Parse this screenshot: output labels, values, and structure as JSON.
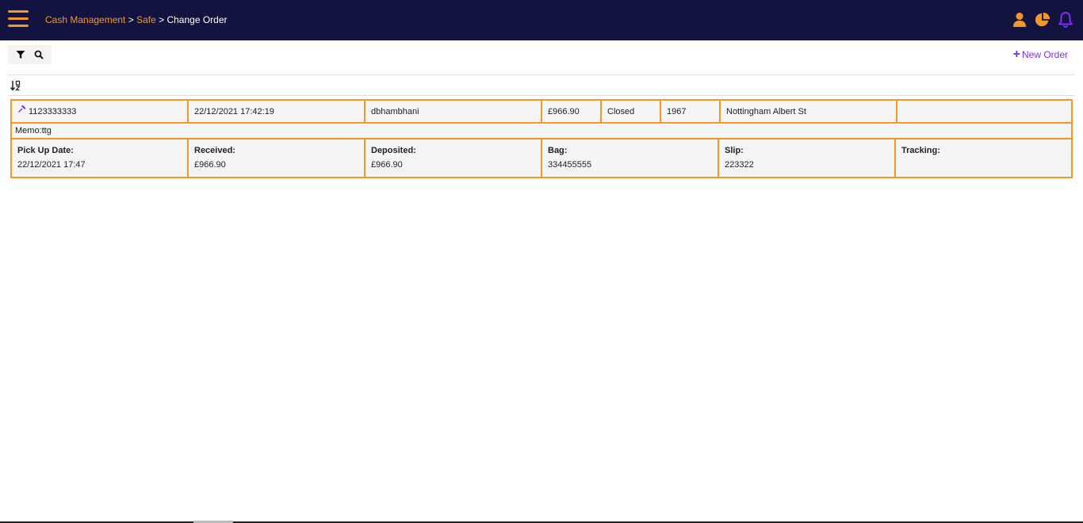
{
  "header": {
    "breadcrumb": {
      "item1": "Cash Management",
      "sep1": " > ",
      "item2": "Safe",
      "sep2": " > ",
      "current": "Change Order"
    },
    "icons": [
      "menu-icon",
      "user-icon",
      "pie-chart-icon",
      "bell-icon"
    ],
    "colors": {
      "bar": "#13133f",
      "accent": "#f5962a",
      "purple": "#7b2ff2"
    }
  },
  "toolbar": {
    "icons": [
      "filter-icon",
      "search-icon",
      "sort-icon"
    ],
    "new_order_label": "New Order"
  },
  "order": {
    "id": "1123333333",
    "datetime": "22/12/2021 17:42:19",
    "user": "dbhambhani",
    "amount": "£966.90",
    "status": "Closed",
    "store_no": "1967",
    "location": "Nottingham Albert St",
    "extra": "",
    "memo": "Memo:ttg",
    "details": [
      {
        "label": "Pick Up Date:",
        "value": "22/12/2021 17:47"
      },
      {
        "label": "Received:",
        "value": "£966.90"
      },
      {
        "label": "Deposited:",
        "value": "£966.90"
      },
      {
        "label": "Bag:",
        "value": "334455555"
      },
      {
        "label": "Slip:",
        "value": "223322"
      },
      {
        "label": "Tracking:",
        "value": ""
      }
    ]
  }
}
